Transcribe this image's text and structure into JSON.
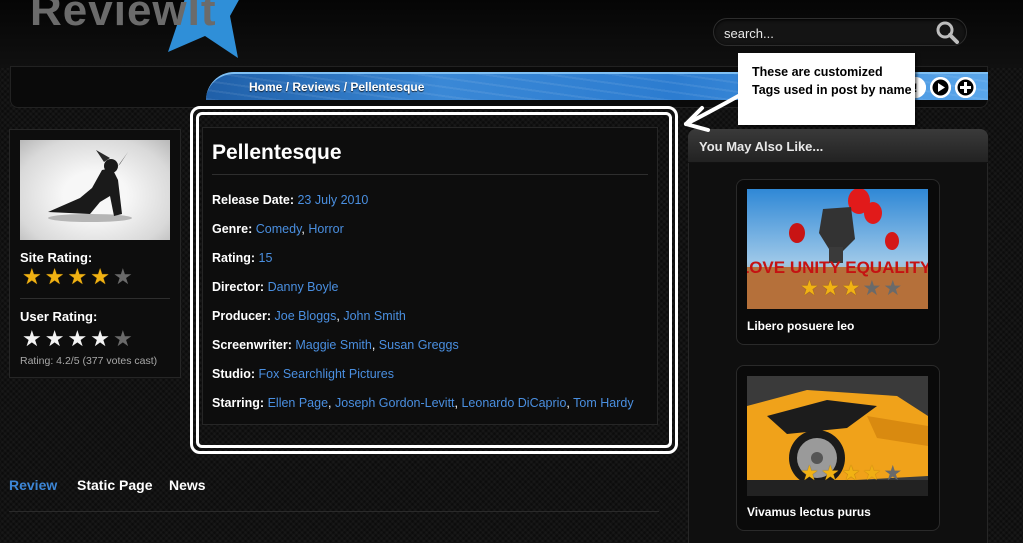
{
  "header": {
    "logo_text": "ReviewIt",
    "search_placeholder": "search...",
    "breadcrumb": "Home / Reviews / Pellentesque"
  },
  "left_panel": {
    "site_rating_label": "Site Rating:",
    "site_rating_stars": 4,
    "user_rating_label": "User Rating:",
    "user_rating_stars": 4,
    "rating_note": "Rating: 4.2/5 (377 votes cast)"
  },
  "post": {
    "title": "Pellentesque",
    "meta": [
      {
        "key": "Release Date:",
        "values": [
          "23 July 2010"
        ]
      },
      {
        "key": "Genre:",
        "values": [
          "Comedy",
          "Horror"
        ]
      },
      {
        "key": "Rating:",
        "values": [
          "15"
        ]
      },
      {
        "key": "Director:",
        "values": [
          "Danny Boyle"
        ]
      },
      {
        "key": "Producer:",
        "values": [
          "Joe Bloggs",
          "John Smith"
        ]
      },
      {
        "key": "Screenwriter:",
        "values": [
          "Maggie Smith",
          "Susan Greggs"
        ]
      },
      {
        "key": "Studio:",
        "values": [
          "Fox Searchlight Pictures"
        ]
      },
      {
        "key": "Starring:",
        "values": [
          "Ellen Page",
          "Joseph Gordon-Levitt",
          "Leonardo DiCaprio",
          "Tom Hardy"
        ]
      }
    ]
  },
  "annotation": {
    "text": "These are customized Tags used in post by name"
  },
  "sidebar": {
    "title": "You May Also Like...",
    "items": [
      {
        "title": "Libero posuere leo",
        "stars": 3,
        "image_text": "LOVE UNITY EQUALITY"
      },
      {
        "title": "Vivamus lectus purus",
        "stars": 3.5
      }
    ]
  },
  "tabs": [
    {
      "label": "Review",
      "active": true
    },
    {
      "label": "Static Page",
      "active": false
    },
    {
      "label": "News",
      "active": false
    }
  ],
  "colors": {
    "link": "#4a8fe0",
    "accent_blue": "#2c7cd0",
    "star_gold": "#f1b213"
  }
}
